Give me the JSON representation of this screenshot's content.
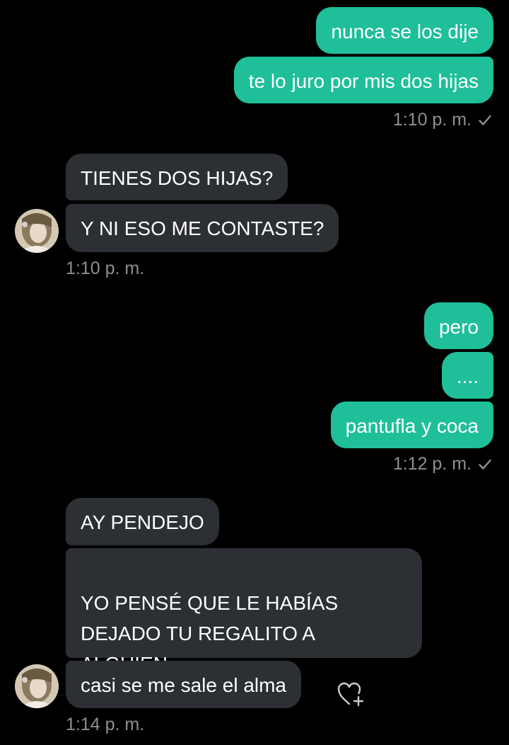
{
  "messages": {
    "m1": "nunca se los dije",
    "m2": "te lo juro por mis dos hijas",
    "t1": "1:10 p. m.",
    "m3": "TIENES DOS HIJAS?",
    "m4": "Y NI ESO ME CONTASTE?",
    "t2": "1:10 p. m.",
    "m5": "pero",
    "m6": "....",
    "m7": "pantufla y coca",
    "t3": "1:12 p. m.",
    "m8": "AY PENDEJO",
    "m9": "YO PENSÉ QUE LE HABÍAS\nDEJADO TU REGALITO A\nALGUIEN",
    "m10": "casi se me sale el alma",
    "t4": "1:14 p. m."
  },
  "icons": {
    "read_receipt": "check-icon",
    "reaction": "heart-add-icon",
    "contact_avatar": "avatar"
  },
  "colors": {
    "background": "#000000",
    "outgoing_bubble": "#1fbf9a",
    "incoming_bubble": "#2c2f33",
    "timestamp": "#8c9094",
    "text": "#ffffff"
  }
}
